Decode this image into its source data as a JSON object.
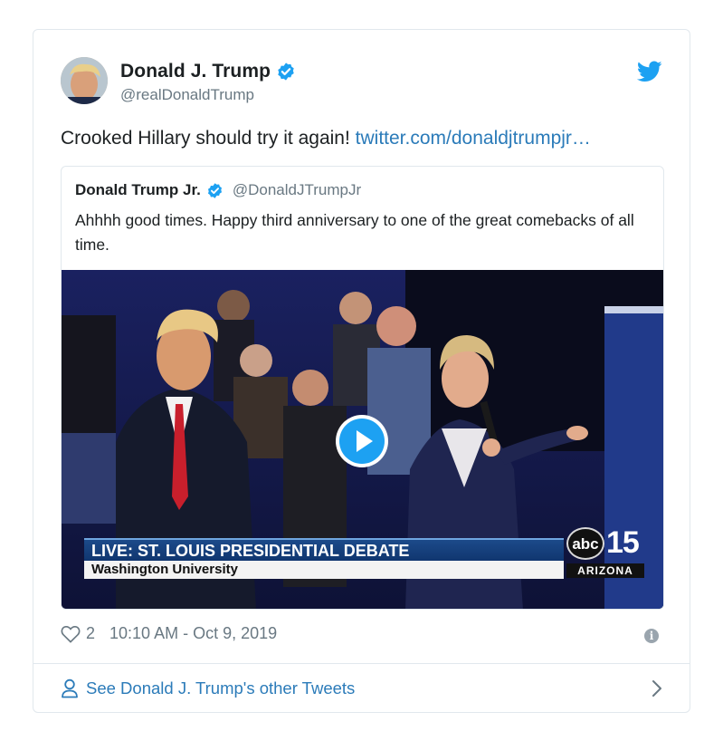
{
  "tweet": {
    "author_name": "Donald J. Trump",
    "handle": "@realDonaldTrump",
    "text": "Crooked Hillary should try it again! ",
    "link_text": "twitter.com/donaldjtrumpjr…",
    "like_count": "2",
    "timestamp": "10:10 AM - Oct 9, 2019"
  },
  "quoted": {
    "author_name": "Donald Trump Jr.",
    "handle": "@DonaldJTrumpJr",
    "text": "Ahhhh good times. Happy third anniversary to one of the great comebacks of all time."
  },
  "video": {
    "banner_title": "LIVE: ST. LOUIS PRESIDENTIAL DEBATE",
    "banner_subtitle": "Washington University",
    "channel_logo": "abc",
    "channel_number": "15",
    "channel_region": "ARIZONA"
  },
  "footer": {
    "link_text": "See Donald J. Trump's other Tweets"
  },
  "icons": {
    "verified": "verified-badge-icon",
    "bird": "twitter-bird-icon",
    "play": "play-icon",
    "like": "heart-icon",
    "info": "info-icon",
    "person": "person-icon",
    "chevron": "chevron-right-icon"
  },
  "colors": {
    "accent": "#1da1f2",
    "link": "#2b7bb9",
    "muted": "#697882",
    "border": "#e1e8ed"
  }
}
